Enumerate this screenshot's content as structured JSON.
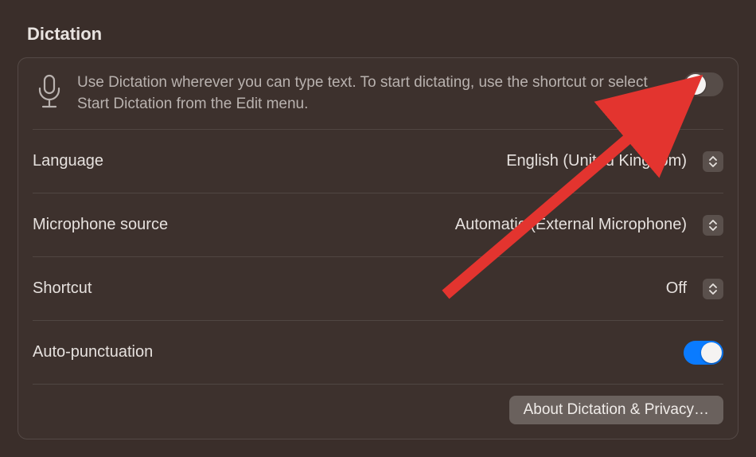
{
  "section_title": "Dictation",
  "intro_text": "Use Dictation wherever you can type text. To start dictating, use the shortcut or select Start Dictation from the Edit menu.",
  "dictation_toggle": {
    "on": false
  },
  "rows": {
    "language": {
      "label": "Language",
      "value": "English (United Kingdom)"
    },
    "mic_source": {
      "label": "Microphone source",
      "value": "Automatic (External Microphone)"
    },
    "shortcut": {
      "label": "Shortcut",
      "value": "Off"
    },
    "auto_punct": {
      "label": "Auto-punctuation",
      "on": true
    }
  },
  "about_button": "About Dictation & Privacy…",
  "colors": {
    "toggle_on": "#0a7bff",
    "toggle_off": "#564c48",
    "arrow": "#e3342f"
  }
}
